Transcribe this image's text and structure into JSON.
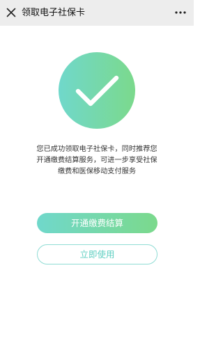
{
  "nav": {
    "title": "领取电子社保卡",
    "close_icon": "close-icon",
    "more_icon": "more-icon"
  },
  "status": {
    "icon": "checkmark-icon",
    "gradient_start": "#70d8cb",
    "gradient_end": "#7bd98c"
  },
  "message": {
    "line1": "您已成功领取电子社保卡，同时推荐您",
    "line2": "开通缴费结算服务，可进一步享受社保",
    "line3": "缴费和医保移动支付服务"
  },
  "actions": {
    "primary_label": "开通缴费结算",
    "secondary_label": "立即使用"
  }
}
